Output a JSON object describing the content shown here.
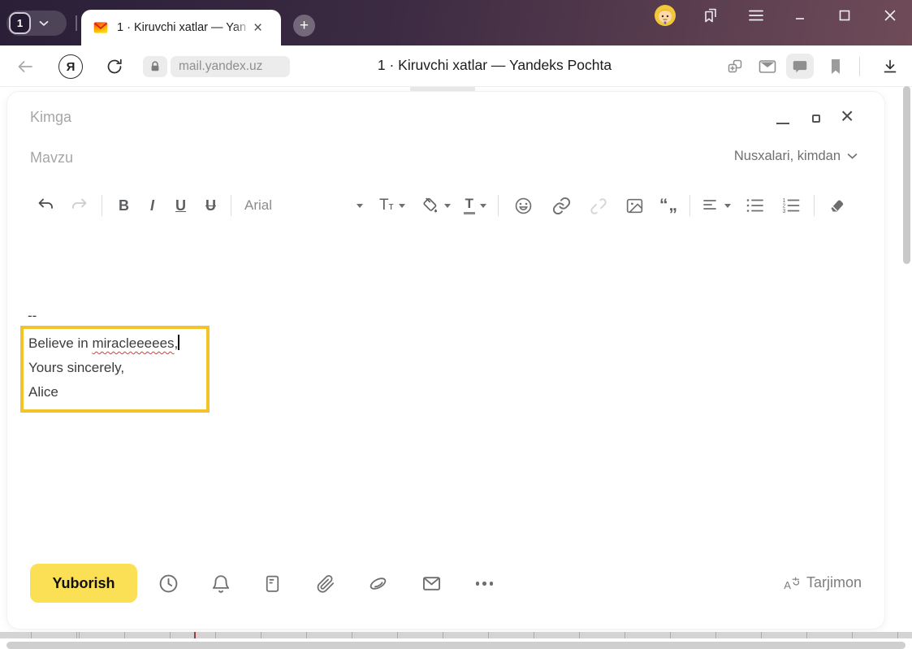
{
  "titlebar": {
    "tab_group_count": "1",
    "active_tab_title": "1 · Kiruvchi xatlar — Yan",
    "tab_close_glyph": "×",
    "new_tab_glyph": "+"
  },
  "navbar": {
    "url": "mail.yandex.uz",
    "page_title": "1 · Kiruvchi xatlar — Yandeks Pochta"
  },
  "compose": {
    "to_placeholder": "Kimga",
    "subject_placeholder": "Mavzu",
    "cc_from_label": "Nusxalari, kimdan",
    "window_close_glyph": "×",
    "toolbar": {
      "bold": "B",
      "italic": "I",
      "underline": "U",
      "strikethrough": "U",
      "font_family": "Arial",
      "font_size_big": "T",
      "font_size_small": "т",
      "text_color": "T",
      "quote_glyphs": "“„",
      "list_num_1": "1",
      "list_num_2": "2",
      "list_num_3": "3"
    },
    "body": {
      "signature_separator": "--",
      "line1_prefix": "Believe in ",
      "line1_misspelled": "miracleeeees",
      "line1_suffix": ",",
      "line2": "Yours sincerely,",
      "line3": "Alice"
    },
    "footer": {
      "send_label": "Yuborish",
      "translator_label": "Tarjimon",
      "translator_letter": "A"
    }
  },
  "colors": {
    "titlebar_gradient_left": "#291f37",
    "titlebar_gradient_right": "#6f4b58",
    "send_button_yellow": "#fbdf55",
    "signature_highlight_border": "#f2c32a",
    "spellcheck_red": "#e03c31",
    "scrollbar_gray": "#c9c9c9"
  }
}
